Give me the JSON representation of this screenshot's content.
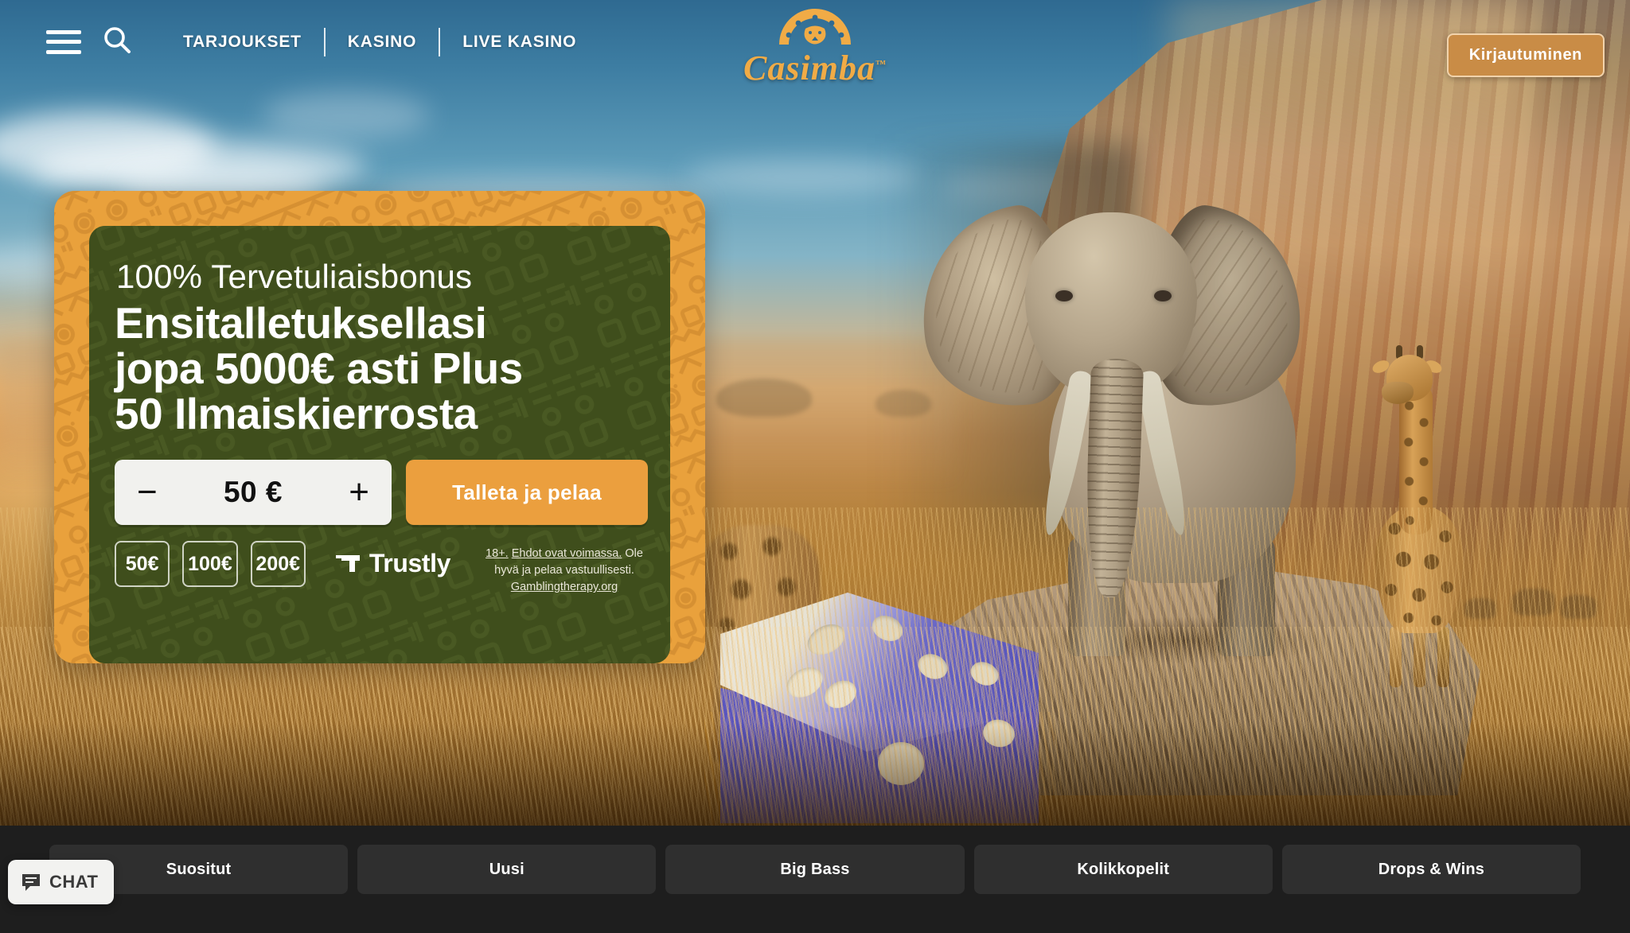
{
  "brand": {
    "logo_text": "Casimba",
    "trademark": "™",
    "accent_orange": "#e9a13c",
    "accent_green": "#3f4e1c",
    "cta_orange": "#eb9f3e",
    "login_bg": "#c98c46"
  },
  "nav": {
    "menu_icon": "hamburger-icon",
    "search_icon": "search-icon",
    "links": [
      {
        "label": "TARJOUKSET"
      },
      {
        "label": "KASINO"
      },
      {
        "label": "LIVE KASINO"
      }
    ],
    "login_label": "Kirjautuminen"
  },
  "promo": {
    "kicker": "100% Tervetuliaisbonus",
    "title_line1": "Ensitalletuksellasi",
    "title_line2": "jopa 5000€ asti Plus",
    "title_line3": "50 Ilmaiskierrosta",
    "stepper": {
      "decrease_label": "−",
      "increase_label": "+",
      "value": "50 €",
      "placeholder": "50 €"
    },
    "cta_label": "Talleta ja pelaa",
    "quick_amounts": [
      {
        "label": "50€"
      },
      {
        "label": "100€"
      },
      {
        "label": "200€"
      }
    ],
    "payment": {
      "icon": "trustly-logo-icon",
      "name": "Trustly"
    },
    "terms": {
      "age": "18+.",
      "conditions": "Ehdot ovat voimassa.",
      "responsible": "Ole hyvä ja pelaa vastuullisesti.",
      "help_link": "Gamblingtherapy.org"
    }
  },
  "categories": [
    {
      "label": "Suositut"
    },
    {
      "label": "Uusi"
    },
    {
      "label": "Big Bass"
    },
    {
      "label": "Kolikkopelit"
    },
    {
      "label": "Drops & Wins"
    }
  ],
  "chat": {
    "icon": "chat-bubble-icon",
    "label": "CHAT"
  },
  "scene": {
    "description_items": [
      "elephant",
      "giraffe",
      "blue-dice",
      "savanna-grass",
      "rock-cliff"
    ]
  }
}
